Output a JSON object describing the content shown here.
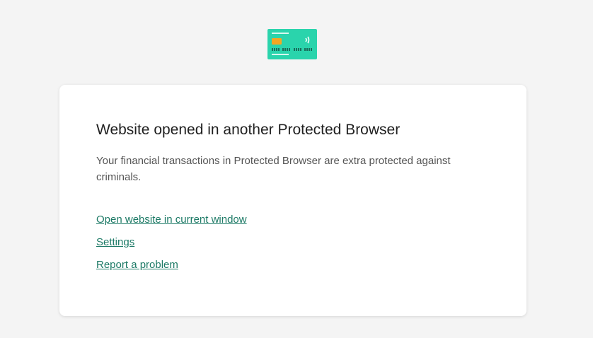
{
  "header": {
    "icon": "payment-card-icon",
    "colors": {
      "card": "#2ad4ac",
      "chip": "#f4a623",
      "card_lines": "#d8f7ef"
    }
  },
  "dialog": {
    "title": "Website opened in another Protected Browser",
    "description": "Your financial transactions in Protected Browser are extra protected against criminals.",
    "links": {
      "open_current": "Open website in current window",
      "settings": "Settings",
      "report": "Report a problem"
    },
    "colors": {
      "link": "#1d7a66",
      "background": "#f4f4f4",
      "panel": "#ffffff"
    }
  }
}
